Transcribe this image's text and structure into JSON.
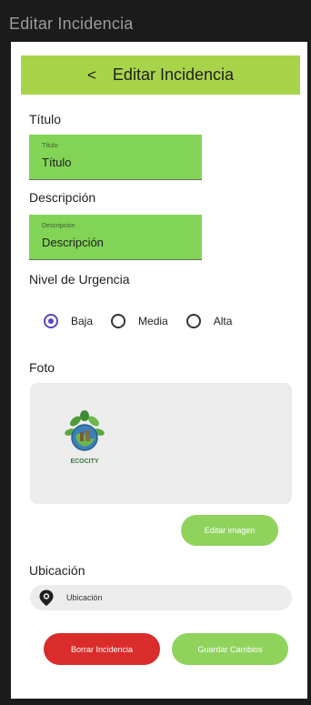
{
  "window": {
    "title": "Editar Incidencia"
  },
  "toolbar": {
    "back_glyph": "<",
    "title": "Editar Incidencia"
  },
  "titulo": {
    "label": "Título",
    "field_label": "Título",
    "value": "Título"
  },
  "descripcion": {
    "label": "Descripción",
    "field_label": "Descripción",
    "value": "Descripción"
  },
  "urgencia": {
    "label": "Nivel de Urgencia",
    "options": [
      {
        "label": "Baja",
        "checked": true
      },
      {
        "label": "Media",
        "checked": false
      },
      {
        "label": "Alta",
        "checked": false
      }
    ]
  },
  "foto": {
    "label": "Foto",
    "logo_text": "ECOCITY",
    "edit_button": "Editar imagen"
  },
  "ubicacion": {
    "label": "Ubicación",
    "placeholder": "Ubicación",
    "icon": "location-pin-icon"
  },
  "actions": {
    "delete": "Borrar Incidencia",
    "save": "Guardar Cambios"
  },
  "colors": {
    "toolbar": "#a8d44a",
    "field": "#82d456",
    "accent_radio": "#5a45c8",
    "delete": "#db2c2c",
    "save": "#8fd35d"
  }
}
